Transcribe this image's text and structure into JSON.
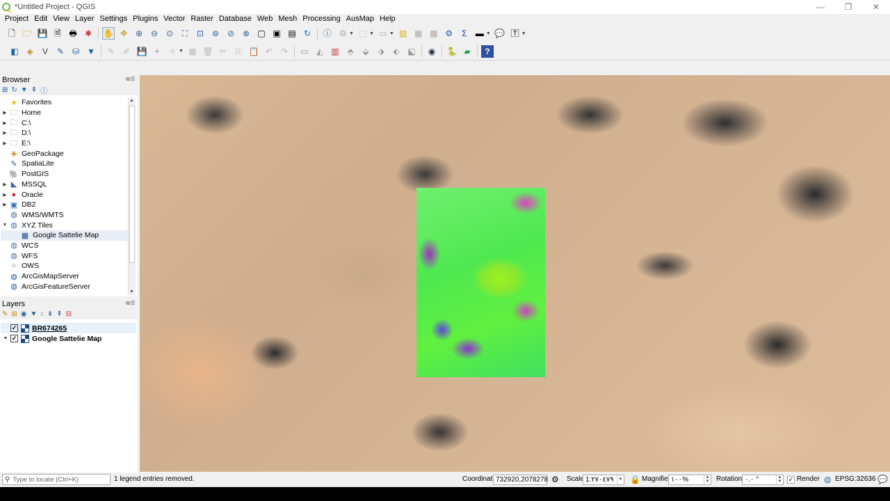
{
  "window": {
    "title": "*Untitled Project - QGIS",
    "min": "—",
    "max": "❐",
    "close": "✕"
  },
  "menu": [
    "Project",
    "Edit",
    "View",
    "Layer",
    "Settings",
    "Plugins",
    "Vector",
    "Raster",
    "Database",
    "Web",
    "Mesh",
    "Processing",
    "AusMap",
    "Help"
  ],
  "browser": {
    "title": "Browser",
    "items": [
      {
        "label": "Favorites",
        "icon": "star-icon",
        "glyph": "★",
        "color": "#e8c020",
        "expand": ""
      },
      {
        "label": "Home",
        "icon": "folder-icon",
        "glyph": "🗀",
        "color": "#b08040",
        "expand": "▶"
      },
      {
        "label": "C:\\",
        "icon": "folder-icon",
        "glyph": "🗀",
        "color": "#888",
        "expand": "▶"
      },
      {
        "label": "D:\\",
        "icon": "folder-icon",
        "glyph": "🗀",
        "color": "#888",
        "expand": "▶"
      },
      {
        "label": "E:\\",
        "icon": "folder-icon",
        "glyph": "🗀",
        "color": "#888",
        "expand": "▶"
      },
      {
        "label": "GeoPackage",
        "icon": "geopackage-icon",
        "glyph": "◈",
        "color": "#c09020",
        "expand": ""
      },
      {
        "label": "SpatiaLite",
        "icon": "spatialite-icon",
        "glyph": "✎",
        "color": "#3060a0",
        "expand": ""
      },
      {
        "label": "PostGIS",
        "icon": "postgis-icon",
        "glyph": "🐘",
        "color": "#336791",
        "expand": ""
      },
      {
        "label": "MSSQL",
        "icon": "mssql-icon",
        "glyph": "◣",
        "color": "#4060a0",
        "expand": "▶"
      },
      {
        "label": "Oracle",
        "icon": "oracle-icon",
        "glyph": "●",
        "color": "#c03030",
        "expand": "▶"
      },
      {
        "label": "DB2",
        "icon": "db2-icon",
        "glyph": "▣",
        "color": "#3070b0",
        "expand": "▶"
      },
      {
        "label": "WMS/WMTS",
        "icon": "globe-icon",
        "glyph": "◍",
        "color": "#4070a0",
        "expand": ""
      },
      {
        "label": "XYZ Tiles",
        "icon": "xyz-tiles-icon",
        "glyph": "◍",
        "color": "#4070a0",
        "expand": "▼"
      },
      {
        "label": "Google Sattelie Map",
        "icon": "raster-tile-icon",
        "glyph": "▦",
        "color": "#1a4a8a",
        "expand": "",
        "child": true
      },
      {
        "label": "WCS",
        "icon": "wcs-icon",
        "glyph": "◍",
        "color": "#4070a0",
        "expand": ""
      },
      {
        "label": "WFS",
        "icon": "wfs-icon",
        "glyph": "◍",
        "color": "#4070a0",
        "expand": ""
      },
      {
        "label": "OWS",
        "icon": "ows-icon",
        "glyph": "○",
        "color": "#4070a0",
        "expand": ""
      },
      {
        "label": "ArcGisMapServer",
        "icon": "arcgis-icon",
        "glyph": "◍",
        "color": "#2060a0",
        "expand": ""
      },
      {
        "label": "ArcGisFeatureServer",
        "icon": "arcgis-icon",
        "glyph": "◍",
        "color": "#2060a0",
        "expand": ""
      }
    ]
  },
  "layers": {
    "title": "Layers",
    "items": [
      {
        "name": "BR674265",
        "checked": "✓",
        "expand": "",
        "selected": true
      },
      {
        "name": "Google Sattelie Map",
        "checked": "✓",
        "expand": "▼",
        "selected": false
      }
    ]
  },
  "status": {
    "locate_placeholder": "Type to locate (Ctrl+K)",
    "message": "1 legend entries removed.",
    "coordinate_label": "Coordinate",
    "coordinate_value": "732920,2078278",
    "scale_label": "Scale",
    "scale_value": "1:٢٧٠٤٧٩",
    "magnifier_label": "Magnifier",
    "magnifier_value": "١٠٠%",
    "rotation_label": "Rotation",
    "rotation_value": "٠.٠ °",
    "render_label": "Render",
    "render_checked": "✓",
    "crs": "EPSG:32636"
  },
  "colors": {
    "accent": "#1a4a8a",
    "qgis_green": "#6ab04c"
  }
}
